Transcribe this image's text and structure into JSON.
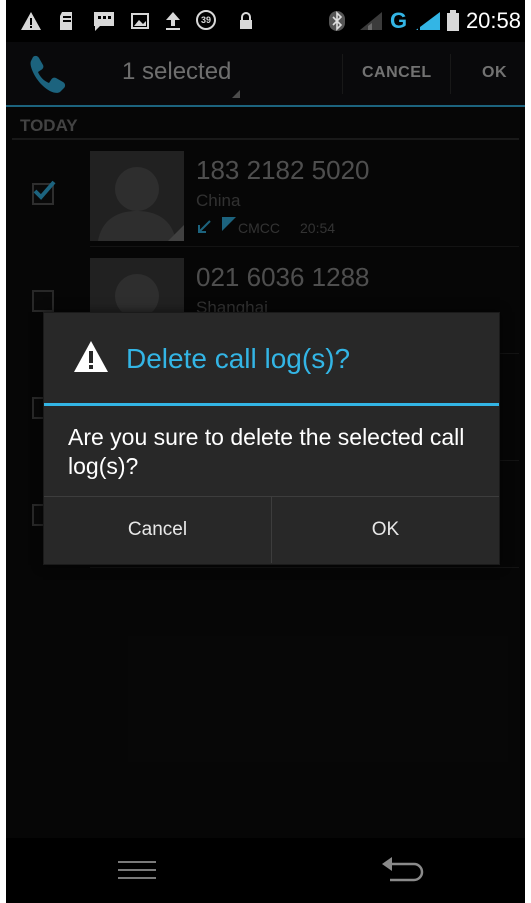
{
  "status_bar": {
    "time": "20:58",
    "notification_count": "39",
    "network_type": "G",
    "icons": [
      "warning-icon",
      "sd-card-icon",
      "message-icon",
      "image-icon",
      "upload-icon",
      "count-badge-icon",
      "lock-icon",
      "bluetooth-icon",
      "signal-icon",
      "battery-icon"
    ]
  },
  "action_bar": {
    "title": "1 selected",
    "cancel_label": "CANCEL",
    "ok_label": "OK",
    "accent": "#33b5e5"
  },
  "list": {
    "section_header": "TODAY",
    "rows": [
      {
        "number": "183 2182 5020",
        "location": "China",
        "carrier": "CMCC",
        "time": "20:54",
        "checked": true
      },
      {
        "number": "021 6036 1288",
        "location": "Shanghai",
        "checked": false
      },
      {
        "checked": false
      },
      {
        "checked": false
      }
    ]
  },
  "dialog": {
    "title": "Delete call log(s)?",
    "message": "Are you sure to delete the selected call log(s)?",
    "cancel_label": "Cancel",
    "ok_label": "OK"
  },
  "nav_bar": {
    "icons": [
      "menu-icon",
      "back-icon"
    ]
  }
}
